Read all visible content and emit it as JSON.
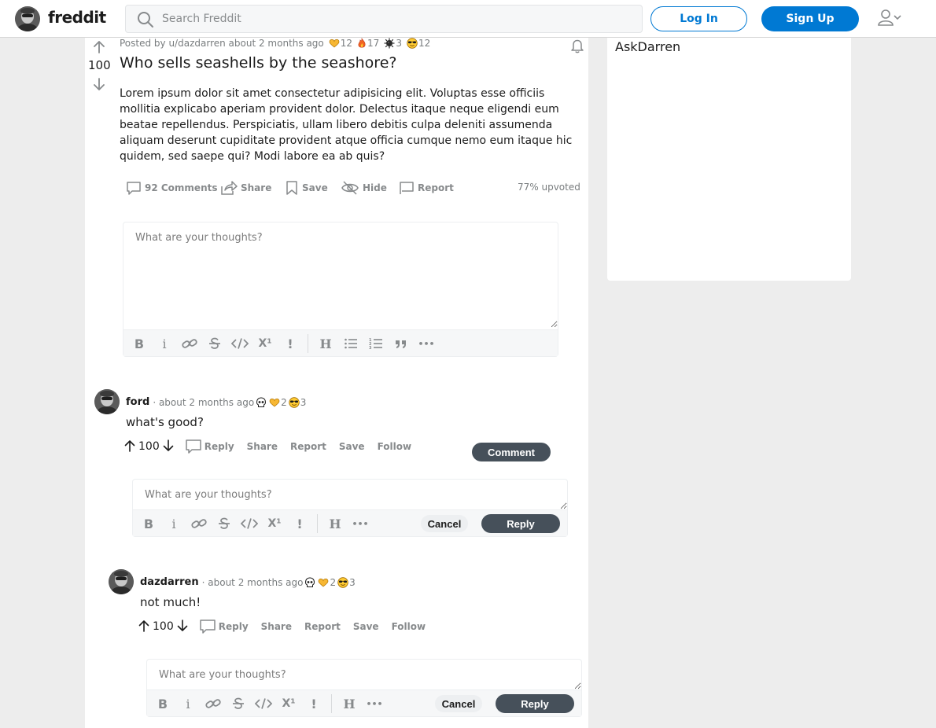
{
  "header": {
    "logo": "freddit",
    "search_placeholder": "Search Freddit",
    "login_label": "Log In",
    "signup_label": "Sign Up"
  },
  "post": {
    "meta": "Posted by u/dazdarren about 2 months ago",
    "awards": [
      {
        "icon": "heart-hands-icon",
        "count": "12"
      },
      {
        "icon": "fire-icon",
        "count": "17"
      },
      {
        "icon": "virus-icon",
        "count": "3"
      },
      {
        "icon": "sunglasses-smiley-icon",
        "count": "12"
      }
    ],
    "score": "100",
    "title": "Who sells seashells by the seashore?",
    "body": "Lorem ipsum dolor sit amet consectetur adipisicing elit. Voluptas esse officiis mollitia explicabo aperiam provident dolor. Delectus itaque neque eligendi eum beatae repellendus. Perspiciatis, ullam libero debitis culpa deleniti assumenda aliquam deserunt cupiditate provident atque officia cumque nemo eum itaque hic quidem, sed saepe qui? Modi labore ea ab quis?",
    "actions": {
      "comments": "92 Comments",
      "share": "Share",
      "save": "Save",
      "hide": "Hide",
      "report": "Report"
    },
    "upvoted": "77% upvoted"
  },
  "editor": {
    "placeholder": "What are your thoughts?",
    "comment_label": "Comment",
    "toolbar": {
      "bold": "B",
      "italic": "i",
      "superscript": "X¹",
      "spoiler": "!",
      "heading": "H",
      "more": "•••"
    }
  },
  "comments": [
    {
      "author": "ford",
      "time": "· about 2 months ago",
      "awards": [
        {
          "icon": "skull-icon",
          "count": ""
        },
        {
          "icon": "heart-hands-icon",
          "count": "2"
        },
        {
          "icon": "sunglasses-smiley-icon",
          "count": "3"
        }
      ],
      "body": "what's good?",
      "score": "100",
      "actions": {
        "reply": "Reply",
        "share": "Share",
        "report": "Report",
        "save": "Save",
        "follow": "Follow"
      },
      "reply_editor": {
        "placeholder": "What are your thoughts?",
        "cancel": "Cancel",
        "reply": "Reply"
      }
    },
    {
      "author": "dazdarren",
      "time": "· about 2 months ago",
      "awards": [
        {
          "icon": "skull-icon",
          "count": ""
        },
        {
          "icon": "heart-hands-icon",
          "count": "2"
        },
        {
          "icon": "sunglasses-smiley-icon",
          "count": "3"
        }
      ],
      "body": "not much!",
      "score": "100",
      "actions": {
        "reply": "Reply",
        "share": "Share",
        "report": "Report",
        "save": "Save",
        "follow": "Follow"
      },
      "reply_editor": {
        "placeholder": "What are your thoughts?",
        "cancel": "Cancel",
        "reply": "Reply"
      }
    }
  ],
  "sidebar": {
    "title": "AskDarren"
  },
  "colors": {
    "accent": "#0079d3",
    "dark_button": "#46505a",
    "page_bg": "#ededed"
  }
}
